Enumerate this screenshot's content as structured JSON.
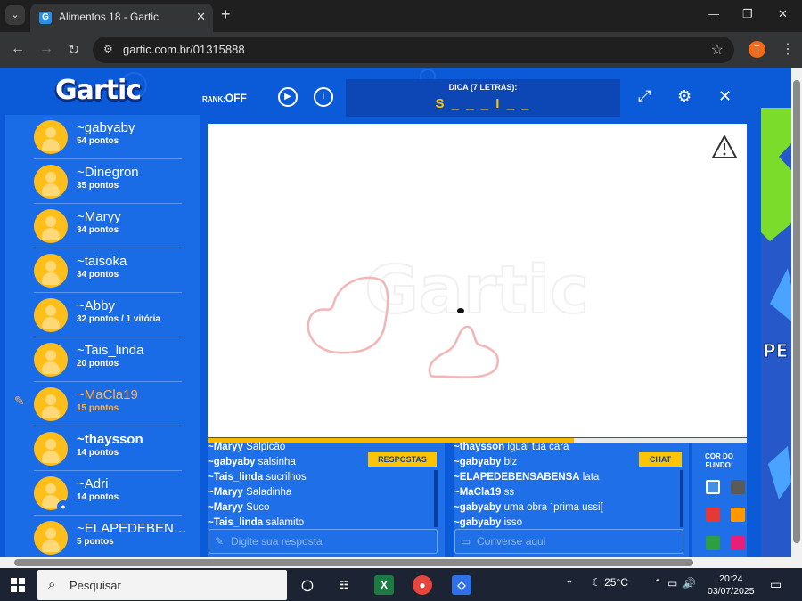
{
  "browser": {
    "tab_title": "Alimentos 18 - Gartic",
    "url": "gartic.com.br/01315888",
    "profile_initial": "T"
  },
  "game": {
    "logo": "Gartic",
    "rank_label": "RANK:",
    "rank_value": "OFF",
    "hint_label": "DICA (7 LETRAS):",
    "hint_word": "S _ _ _ I _ _",
    "watermark": "Gartic",
    "timer_fraction": 0.68,
    "players": [
      {
        "name": "~gabyaby",
        "points": "54 pontos"
      },
      {
        "name": "~Dinegron",
        "points": "35 pontos"
      },
      {
        "name": "~Maryy",
        "points": "34 pontos"
      },
      {
        "name": "~taisoka",
        "points": "34 pontos"
      },
      {
        "name": "~Abby",
        "points": "32 pontos / 1 vitória"
      },
      {
        "name": "~Tais_linda",
        "points": "20 pontos"
      },
      {
        "name": "~MaCla19",
        "points": "15 pontos"
      },
      {
        "name": "~thaysson",
        "points": "14 pontos"
      },
      {
        "name": "~Adri",
        "points": "14 pontos"
      },
      {
        "name": "~ELAPEDEBEN…",
        "points": "5 pontos"
      }
    ],
    "answers": {
      "button": "RESPOSTAS",
      "placeholder": "Digite sua resposta",
      "messages": [
        {
          "user": "~Maryy",
          "text": "Salpicão"
        },
        {
          "user": "~gabyaby",
          "text": "salsinha"
        },
        {
          "user": "~Tais_linda",
          "text": "sucrilhos"
        },
        {
          "user": "~Maryy",
          "text": "Saladinha"
        },
        {
          "user": "~Maryy",
          "text": "Suco"
        },
        {
          "user": "~Tais_linda",
          "text": "salamito"
        }
      ]
    },
    "chat": {
      "button": "CHAT",
      "placeholder": "Converse aqui",
      "messages": [
        {
          "user": "~thaysson",
          "text": "igual tua cara"
        },
        {
          "user": "~gabyaby",
          "text": "blz"
        },
        {
          "user": "~ELAPEDEBENSABENSA",
          "text": "lata"
        },
        {
          "user": "~MaCla19",
          "text": "ss"
        },
        {
          "user": "~gabyaby",
          "text": "uma obra ´prima ussi["
        },
        {
          "user": "~gabyaby",
          "text": "isso"
        }
      ]
    },
    "bg_color_label": "COR DO FUNDO:",
    "bg_colors": [
      "#4a90e2",
      "#5a5a5a",
      "#e53935",
      "#ff9800",
      "#2e9e44",
      "#e91e78"
    ],
    "side_ad_text": "PE JU"
  },
  "taskbar": {
    "search_placeholder": "Pesquisar",
    "temperature": "25°C",
    "time": "20:24",
    "date": "03/07/2025"
  }
}
